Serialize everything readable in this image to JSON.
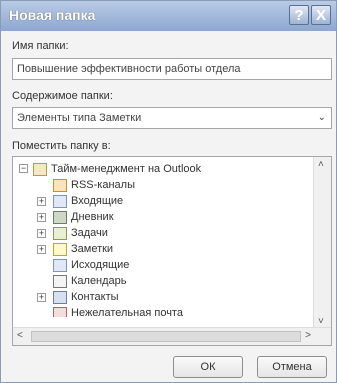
{
  "dialog": {
    "title": "Новая папка",
    "help_glyph": "?",
    "close_glyph": "X"
  },
  "name": {
    "label": "Имя папки:",
    "value": "Повышение эффективности работы отдела"
  },
  "content": {
    "label": "Содержимое папки:",
    "value": "Элементы типа Заметки"
  },
  "location": {
    "label": "Поместить папку в:"
  },
  "tree": {
    "root": "Тайм-менеджмент на Outlook",
    "items": [
      {
        "label": "RSS-каналы",
        "expander": "",
        "icon": "rss-folder-icon"
      },
      {
        "label": "Входящие",
        "expander": "+",
        "icon": "inbox-folder-icon"
      },
      {
        "label": "Дневник",
        "expander": "+",
        "icon": "journal-folder-icon"
      },
      {
        "label": "Задачи",
        "expander": "+",
        "icon": "tasks-folder-icon"
      },
      {
        "label": "Заметки",
        "expander": "+",
        "icon": "notes-folder-icon"
      },
      {
        "label": "Исходящие",
        "expander": "",
        "icon": "outbox-folder-icon"
      },
      {
        "label": "Календарь",
        "expander": "",
        "icon": "calendar-folder-icon"
      },
      {
        "label": "Контакты",
        "expander": "+",
        "icon": "contacts-folder-icon"
      },
      {
        "label": "Нежелательная почта",
        "expander": "",
        "icon": "junk-folder-icon"
      }
    ]
  },
  "buttons": {
    "ok": "ОК",
    "cancel": "Отмена"
  }
}
